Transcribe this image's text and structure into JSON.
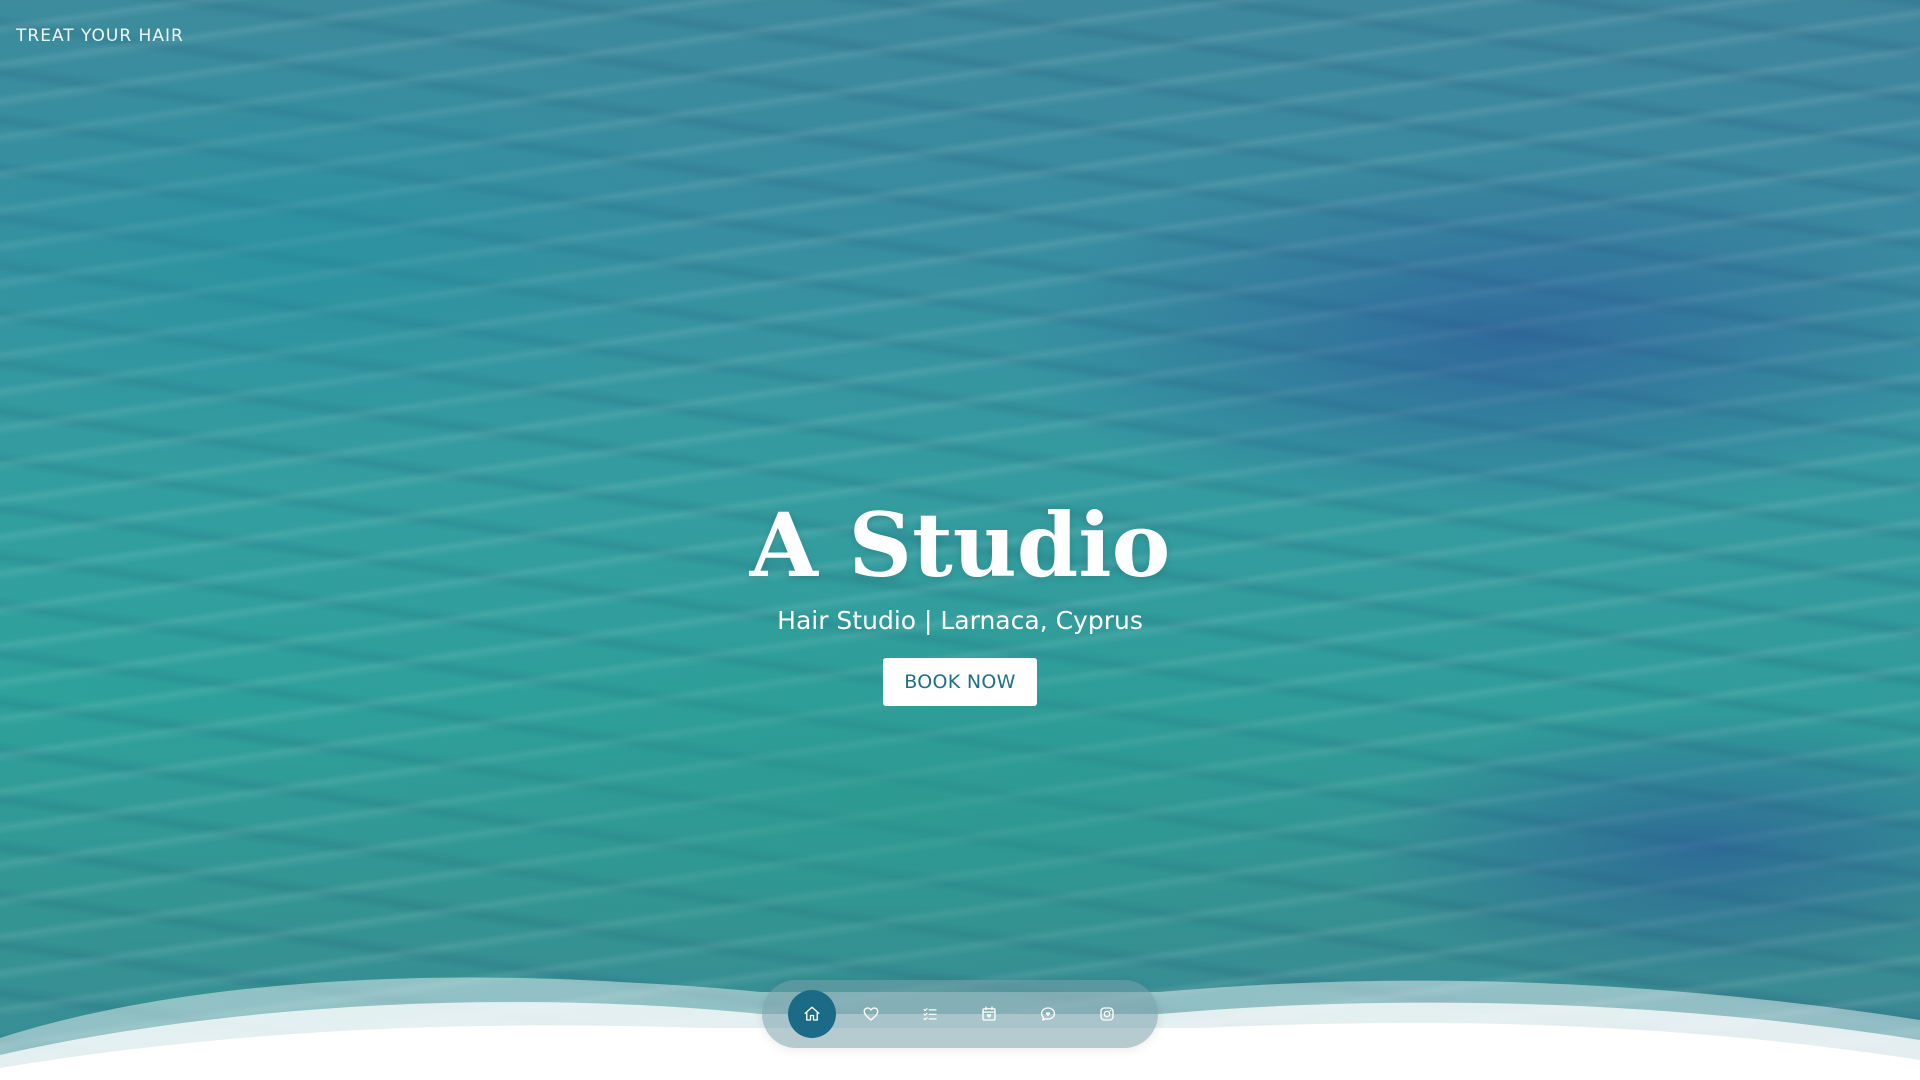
{
  "header": {
    "brand_tagline": "TREAT YOUR HAIR"
  },
  "hero": {
    "title": "A Studio",
    "subtitle": "Hair Studio | Larnaca, Cyprus",
    "cta_label": "BOOK NOW"
  },
  "bottom_nav": {
    "items": [
      {
        "icon": "home-icon",
        "active": true
      },
      {
        "icon": "heart-icon",
        "active": false
      },
      {
        "icon": "list-icon",
        "active": false
      },
      {
        "icon": "calendar-icon",
        "active": false
      },
      {
        "icon": "chat-heart-icon",
        "active": false
      },
      {
        "icon": "instagram-icon",
        "active": false
      }
    ]
  },
  "colors": {
    "accent": "#1b6a86",
    "button_text": "#1f6f86",
    "water_teal": "#2fa39a",
    "water_blue": "#3a6fa0"
  }
}
